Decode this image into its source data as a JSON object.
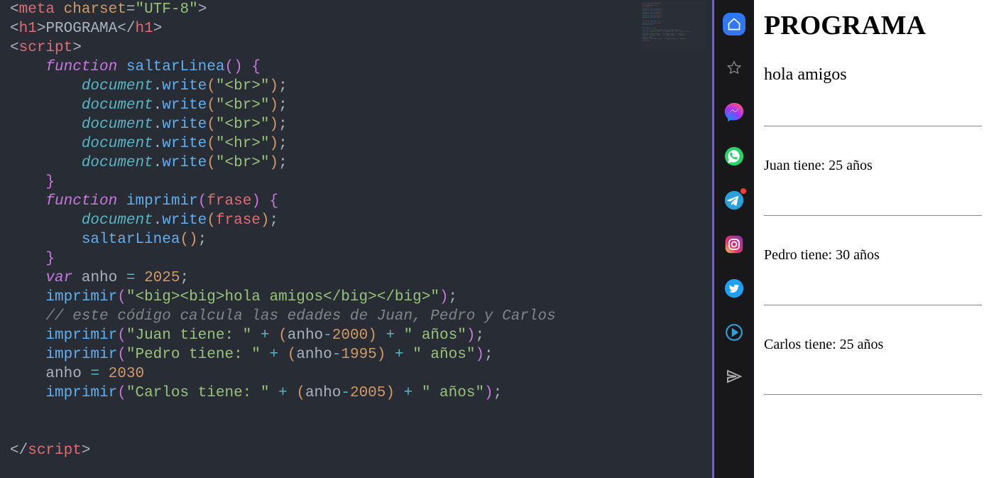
{
  "code": {
    "lines": [
      [
        {
          "c": "t-punc",
          "t": "<"
        },
        {
          "c": "t-red",
          "t": "meta"
        },
        {
          "c": "t-punc",
          "t": " "
        },
        {
          "c": "t-attr",
          "t": "charset"
        },
        {
          "c": "t-punc",
          "t": "="
        },
        {
          "c": "t-str",
          "t": "\"UTF-8\""
        },
        {
          "c": "t-punc",
          "t": ">"
        }
      ],
      [
        {
          "c": "t-punc",
          "t": "<"
        },
        {
          "c": "t-red",
          "t": "h1"
        },
        {
          "c": "t-punc",
          "t": ">"
        },
        {
          "c": "t-grey",
          "t": "PROGRAMA"
        },
        {
          "c": "t-punc",
          "t": "</"
        },
        {
          "c": "t-red",
          "t": "h1"
        },
        {
          "c": "t-punc",
          "t": ">"
        }
      ],
      [
        {
          "c": "t-punc",
          "t": "<"
        },
        {
          "c": "t-red",
          "t": "script"
        },
        {
          "c": "t-punc",
          "t": ">"
        }
      ],
      [
        {
          "c": "",
          "t": "    "
        },
        {
          "c": "t-kw",
          "t": "function"
        },
        {
          "c": "",
          "t": " "
        },
        {
          "c": "t-fn",
          "t": "saltarLinea"
        },
        {
          "c": "t-brace",
          "t": "()"
        },
        {
          "c": "",
          "t": " "
        },
        {
          "c": "t-brace",
          "t": "{"
        }
      ],
      [
        {
          "c": "",
          "t": "        "
        },
        {
          "c": "t-var",
          "t": "document"
        },
        {
          "c": "t-punc",
          "t": "."
        },
        {
          "c": "t-fn",
          "t": "write"
        },
        {
          "c": "t-brace2",
          "t": "("
        },
        {
          "c": "t-str",
          "t": "\"<br>\""
        },
        {
          "c": "t-brace2",
          "t": ")"
        },
        {
          "c": "t-punc",
          "t": ";"
        }
      ],
      [
        {
          "c": "",
          "t": "        "
        },
        {
          "c": "t-var",
          "t": "document"
        },
        {
          "c": "t-punc",
          "t": "."
        },
        {
          "c": "t-fn",
          "t": "write"
        },
        {
          "c": "t-brace2",
          "t": "("
        },
        {
          "c": "t-str",
          "t": "\"<br>\""
        },
        {
          "c": "t-brace2",
          "t": ")"
        },
        {
          "c": "t-punc",
          "t": ";"
        }
      ],
      [
        {
          "c": "",
          "t": "        "
        },
        {
          "c": "t-var",
          "t": "document"
        },
        {
          "c": "t-punc",
          "t": "."
        },
        {
          "c": "t-fn",
          "t": "write"
        },
        {
          "c": "t-brace2",
          "t": "("
        },
        {
          "c": "t-str",
          "t": "\"<br>\""
        },
        {
          "c": "t-brace2",
          "t": ")"
        },
        {
          "c": "t-punc",
          "t": ";"
        }
      ],
      [
        {
          "c": "",
          "t": "        "
        },
        {
          "c": "t-var",
          "t": "document"
        },
        {
          "c": "t-punc",
          "t": "."
        },
        {
          "c": "t-fn",
          "t": "write"
        },
        {
          "c": "t-brace2",
          "t": "("
        },
        {
          "c": "t-str",
          "t": "\"<hr>\""
        },
        {
          "c": "t-brace2",
          "t": ")"
        },
        {
          "c": "t-punc",
          "t": ";"
        }
      ],
      [
        {
          "c": "",
          "t": "        "
        },
        {
          "c": "t-var",
          "t": "document"
        },
        {
          "c": "t-punc",
          "t": "."
        },
        {
          "c": "t-fn",
          "t": "write"
        },
        {
          "c": "t-brace2",
          "t": "("
        },
        {
          "c": "t-str",
          "t": "\"<br>\""
        },
        {
          "c": "t-brace2",
          "t": ")"
        },
        {
          "c": "t-punc",
          "t": ";"
        }
      ],
      [
        {
          "c": "",
          "t": "    "
        },
        {
          "c": "t-brace",
          "t": "}"
        }
      ],
      [
        {
          "c": "",
          "t": "    "
        },
        {
          "c": "t-kw",
          "t": "function"
        },
        {
          "c": "",
          "t": " "
        },
        {
          "c": "t-fn",
          "t": "imprimir"
        },
        {
          "c": "t-brace",
          "t": "("
        },
        {
          "c": "t-red",
          "t": "frase"
        },
        {
          "c": "t-brace",
          "t": ")"
        },
        {
          "c": "",
          "t": " "
        },
        {
          "c": "t-brace",
          "t": "{"
        }
      ],
      [
        {
          "c": "",
          "t": "        "
        },
        {
          "c": "t-var",
          "t": "document"
        },
        {
          "c": "t-punc",
          "t": "."
        },
        {
          "c": "t-fn",
          "t": "write"
        },
        {
          "c": "t-brace2",
          "t": "("
        },
        {
          "c": "t-red",
          "t": "frase"
        },
        {
          "c": "t-brace2",
          "t": ")"
        },
        {
          "c": "t-punc",
          "t": ";"
        }
      ],
      [
        {
          "c": "",
          "t": "        "
        },
        {
          "c": "t-fn",
          "t": "saltarLinea"
        },
        {
          "c": "t-brace2",
          "t": "()"
        },
        {
          "c": "t-punc",
          "t": ";"
        }
      ],
      [
        {
          "c": "",
          "t": "    "
        },
        {
          "c": "t-brace",
          "t": "}"
        }
      ],
      [
        {
          "c": "",
          "t": "    "
        },
        {
          "c": "t-kw",
          "t": "var"
        },
        {
          "c": "",
          "t": " "
        },
        {
          "c": "t-grey",
          "t": "anho "
        },
        {
          "c": "t-op",
          "t": "="
        },
        {
          "c": "",
          "t": " "
        },
        {
          "c": "t-num",
          "t": "2025"
        },
        {
          "c": "t-punc",
          "t": ";"
        }
      ],
      [
        {
          "c": "",
          "t": "    "
        },
        {
          "c": "t-fn",
          "t": "imprimir"
        },
        {
          "c": "t-brace",
          "t": "("
        },
        {
          "c": "t-str",
          "t": "\"<big><big>hola amigos</big></big>\""
        },
        {
          "c": "t-brace",
          "t": ")"
        },
        {
          "c": "t-punc",
          "t": ";"
        }
      ],
      [
        {
          "c": "",
          "t": "    "
        },
        {
          "c": "t-cmt",
          "t": "// este código calcula las edades de Juan, Pedro y Carlos"
        }
      ],
      [
        {
          "c": "",
          "t": "    "
        },
        {
          "c": "t-fn",
          "t": "imprimir"
        },
        {
          "c": "t-brace",
          "t": "("
        },
        {
          "c": "t-str",
          "t": "\"Juan tiene: \""
        },
        {
          "c": "",
          "t": " "
        },
        {
          "c": "t-op",
          "t": "+"
        },
        {
          "c": "",
          "t": " "
        },
        {
          "c": "t-brace2",
          "t": "("
        },
        {
          "c": "t-grey",
          "t": "anho"
        },
        {
          "c": "t-op",
          "t": "-"
        },
        {
          "c": "t-num",
          "t": "2000"
        },
        {
          "c": "t-brace2",
          "t": ")"
        },
        {
          "c": "",
          "t": " "
        },
        {
          "c": "t-op",
          "t": "+"
        },
        {
          "c": "",
          "t": " "
        },
        {
          "c": "t-str",
          "t": "\" años\""
        },
        {
          "c": "t-brace",
          "t": ")"
        },
        {
          "c": "t-punc",
          "t": ";"
        }
      ],
      [
        {
          "c": "",
          "t": "    "
        },
        {
          "c": "t-fn",
          "t": "imprimir"
        },
        {
          "c": "t-brace",
          "t": "("
        },
        {
          "c": "t-str",
          "t": "\"Pedro tiene: \""
        },
        {
          "c": "",
          "t": " "
        },
        {
          "c": "t-op",
          "t": "+"
        },
        {
          "c": "",
          "t": " "
        },
        {
          "c": "t-brace2",
          "t": "("
        },
        {
          "c": "t-grey",
          "t": "anho"
        },
        {
          "c": "t-op",
          "t": "-"
        },
        {
          "c": "t-num",
          "t": "1995"
        },
        {
          "c": "t-brace2",
          "t": ")"
        },
        {
          "c": "",
          "t": " "
        },
        {
          "c": "t-op",
          "t": "+"
        },
        {
          "c": "",
          "t": " "
        },
        {
          "c": "t-str",
          "t": "\" años\""
        },
        {
          "c": "t-brace",
          "t": ")"
        },
        {
          "c": "t-punc",
          "t": ";"
        }
      ],
      [
        {
          "c": "",
          "t": "    "
        },
        {
          "c": "t-grey",
          "t": "anho "
        },
        {
          "c": "t-op",
          "t": "="
        },
        {
          "c": "",
          "t": " "
        },
        {
          "c": "t-num",
          "t": "2030"
        }
      ],
      [
        {
          "c": "",
          "t": "    "
        },
        {
          "c": "t-fn",
          "t": "imprimir"
        },
        {
          "c": "t-brace",
          "t": "("
        },
        {
          "c": "t-str",
          "t": "\"Carlos tiene: \""
        },
        {
          "c": "",
          "t": " "
        },
        {
          "c": "t-op",
          "t": "+"
        },
        {
          "c": "",
          "t": " "
        },
        {
          "c": "t-brace2",
          "t": "("
        },
        {
          "c": "t-grey",
          "t": "anho"
        },
        {
          "c": "t-op",
          "t": "-"
        },
        {
          "c": "t-num",
          "t": "2005"
        },
        {
          "c": "t-brace2",
          "t": ")"
        },
        {
          "c": "",
          "t": " "
        },
        {
          "c": "t-op",
          "t": "+"
        },
        {
          "c": "",
          "t": " "
        },
        {
          "c": "t-str",
          "t": "\" años\""
        },
        {
          "c": "t-brace",
          "t": ")"
        },
        {
          "c": "t-punc",
          "t": ";"
        }
      ],
      [
        {
          "c": "",
          "t": " "
        }
      ],
      [
        {
          "c": "",
          "t": " "
        }
      ],
      [
        {
          "c": "t-punc",
          "t": "</"
        },
        {
          "c": "t-red",
          "t": "script"
        },
        {
          "c": "t-punc",
          "t": ">"
        }
      ]
    ]
  },
  "sidebar": {
    "icons": [
      "home",
      "star",
      "messenger",
      "whatsapp",
      "telegram",
      "instagram",
      "twitter",
      "play",
      "send"
    ]
  },
  "preview": {
    "title": "PROGRAMA",
    "big_line": "hola amigos",
    "lines": [
      "Juan tiene: 25 años",
      "Pedro tiene: 30 años",
      "Carlos tiene: 25 años"
    ]
  }
}
